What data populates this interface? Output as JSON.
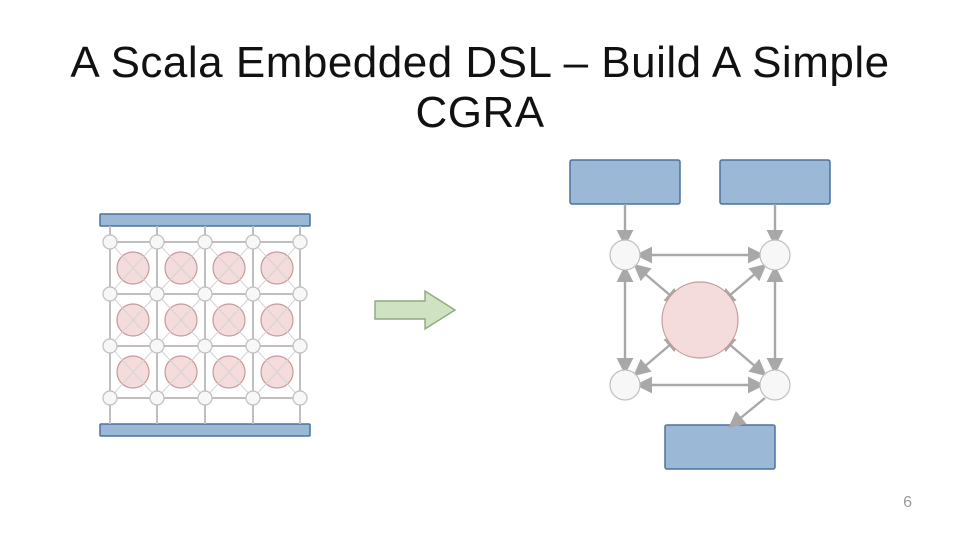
{
  "slide": {
    "title": "A Scala Embedded DSL – Build A Simple CGRA",
    "page_number": "6"
  },
  "chart_data": {
    "type": "diagram",
    "title": "A Scala Embedded DSL – Build A Simple CGRA",
    "left_figure": {
      "description": "4x4 CGRA array overview",
      "grid_rows": 4,
      "grid_cols": 4,
      "big_nodes_rows": 3,
      "big_nodes_cols": 4,
      "switch_node_rows": 4,
      "switch_node_cols": 5,
      "top_bar": true,
      "bottom_bar": true
    },
    "transition": {
      "symbol": "green-arrow",
      "meaning": "zoom / expand"
    },
    "right_figure": {
      "description": "Single CGRA tile detail",
      "io_blocks": {
        "top_left": true,
        "top_right": true,
        "bottom": true
      },
      "corner_switches": 4,
      "center_pe": true,
      "edges": [
        "top-left-block → top-left-switch",
        "top-right-block → top-right-switch",
        "bottom-block ↔ bottom-right-switch",
        "top-left-switch ↔ top-right-switch",
        "top-left-switch ↔ bottom-left-switch",
        "top-right-switch ↔ bottom-right-switch",
        "bottom-left-switch ↔ bottom-right-switch",
        "top-left-switch ↔ center-pe",
        "top-right-switch ↔ center-pe",
        "bottom-left-switch ↔ center-pe",
        "bottom-right-switch ↔ center-pe"
      ]
    }
  }
}
